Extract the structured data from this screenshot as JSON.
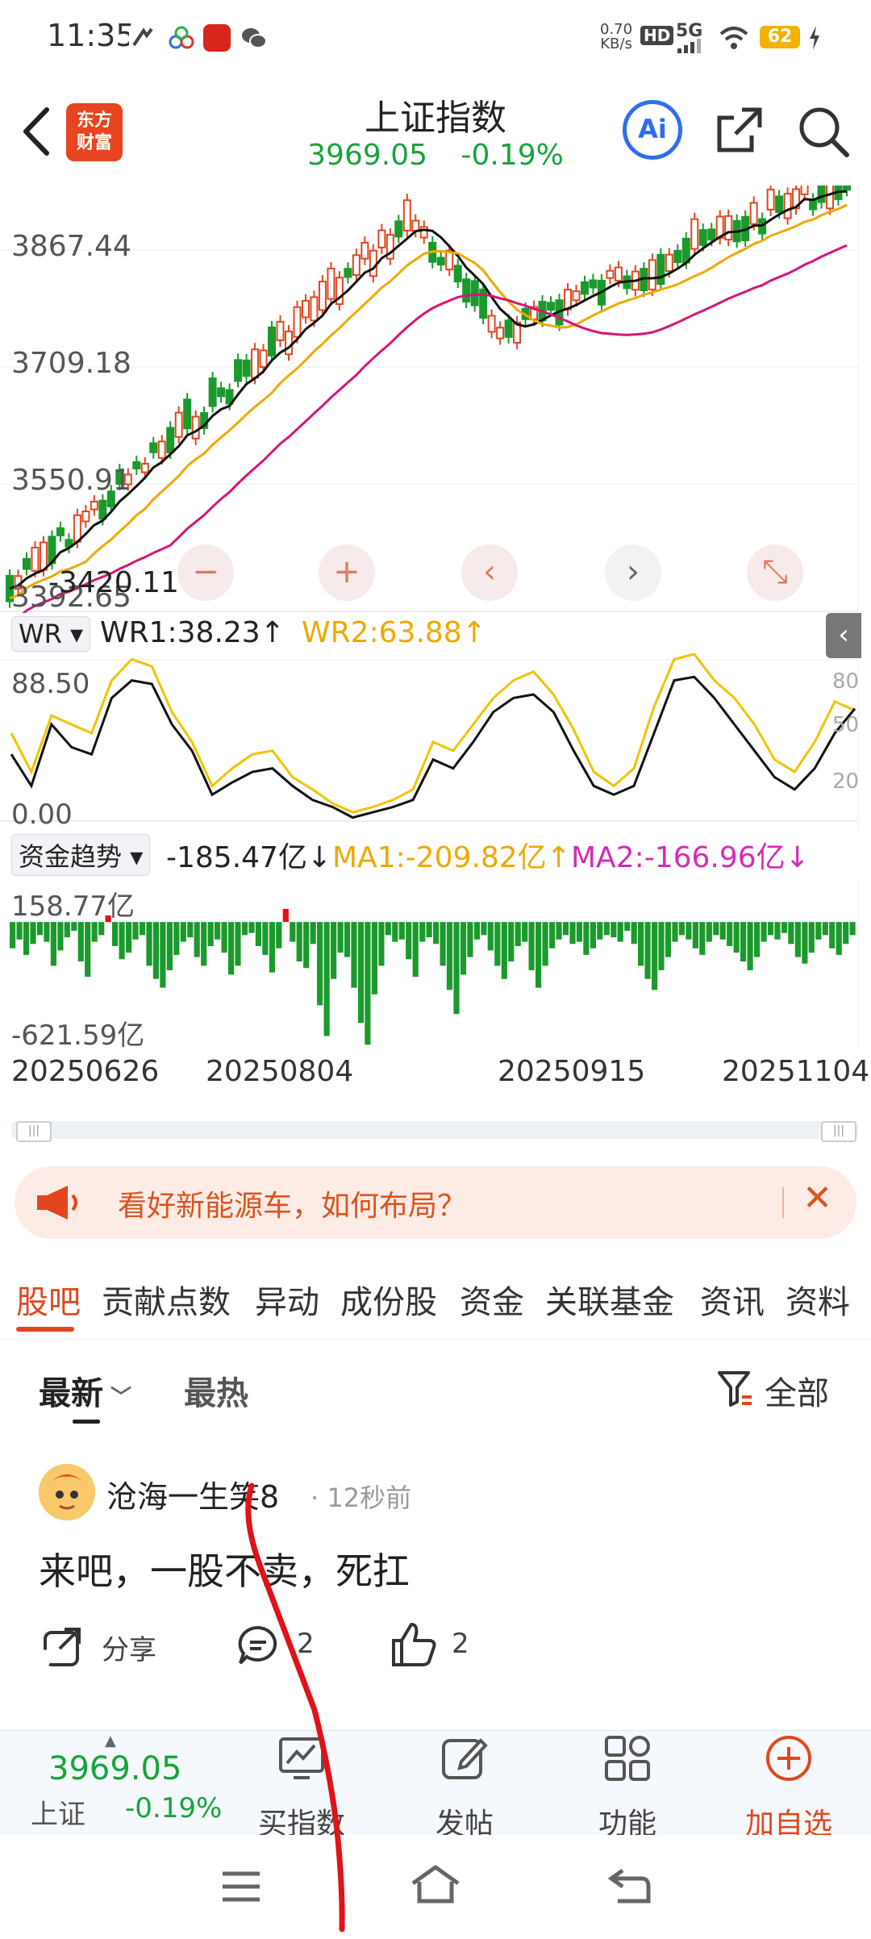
{
  "status_bar": {
    "time": "11:35",
    "net_speed_value": "0.70",
    "net_speed_unit": "KB/s",
    "hd_label": "HD",
    "network": "5G",
    "battery": "62"
  },
  "header": {
    "logo_text_line1": "东方",
    "logo_text_line2": "财富",
    "title": "上证指数",
    "price": "3969.05",
    "change": "-0.19%",
    "ai_label": "Ai"
  },
  "kline": {
    "y_labels": [
      "3867.44",
      "3709.18",
      "3550.91",
      "3392.65"
    ],
    "low_marker": "3420.11",
    "buttons": [
      "−",
      "+",
      "‹",
      "›",
      "⤡"
    ],
    "colors": {
      "up": "#e2461e",
      "down": "#1a9a2c",
      "ma5": "#111111",
      "ma10": "#f0a800",
      "ma20": "#d6157a",
      "seq": "#ff6a2b"
    }
  },
  "wr": {
    "selector": "WR",
    "wr1_label": "WR1:38.23↑",
    "wr2_label": "WR2:63.88↑",
    "y_top": "88.50",
    "y_bottom": "0.00",
    "right_labels": [
      "80",
      "50",
      "20"
    ],
    "wr1_values": [
      38,
      20,
      55,
      42,
      38,
      70,
      80,
      78,
      55,
      40,
      15,
      22,
      28,
      30,
      20,
      12,
      8,
      2,
      5,
      8,
      12,
      35,
      30,
      45,
      62,
      70,
      72,
      62,
      40,
      20,
      15,
      20,
      50,
      80,
      82,
      70,
      55,
      40,
      25,
      18,
      30,
      50,
      64
    ],
    "wr2_values": [
      50,
      28,
      60,
      55,
      50,
      80,
      92,
      88,
      62,
      45,
      20,
      30,
      38,
      40,
      25,
      18,
      10,
      5,
      8,
      12,
      18,
      45,
      40,
      55,
      70,
      80,
      85,
      72,
      52,
      28,
      20,
      30,
      65,
      92,
      95,
      80,
      70,
      55,
      35,
      28,
      45,
      68,
      63
    ]
  },
  "fund": {
    "selector": "资金趋势",
    "value_label": "-185.47亿↓",
    "ma1_label": "MA1:-209.82亿↑",
    "ma2_label": "MA2:-166.96亿↓",
    "y_top": "158.77亿",
    "y_bottom": "-621.59亿",
    "bars": [
      -120,
      -80,
      -150,
      -100,
      -60,
      -90,
      -200,
      -130,
      -70,
      -40,
      -180,
      -250,
      -90,
      -60,
      30,
      -110,
      -170,
      -140,
      -80,
      -60,
      -200,
      -260,
      -300,
      -220,
      -150,
      -90,
      -70,
      -160,
      -200,
      -110,
      -80,
      -140,
      -240,
      -200,
      -60,
      -50,
      -110,
      -150,
      -230,
      -120,
      60,
      -90,
      -180,
      -210,
      -100,
      -380,
      -520,
      -260,
      -140,
      -160,
      -300,
      -460,
      -560,
      -330,
      -200,
      -60,
      -90,
      -80,
      -170,
      -250,
      -90,
      -70,
      -100,
      -200,
      -310,
      -420,
      -240,
      -160,
      -80,
      -60,
      -130,
      -200,
      -260,
      -180,
      -110,
      -90,
      -220,
      -300,
      -200,
      -120,
      -80,
      -60,
      -100,
      -90,
      -150,
      -120,
      -80,
      -60,
      -70,
      -90,
      -40,
      -100,
      -200,
      -260,
      -310,
      -220,
      -160,
      -90,
      -60,
      -80,
      -120,
      -150,
      -90,
      -60,
      -80,
      -110,
      -140,
      -180,
      -220,
      -160,
      -90,
      -60,
      -80,
      -50,
      -100,
      -160,
      -190,
      -140,
      -80,
      -60,
      -120,
      -150,
      -100,
      -60
    ]
  },
  "x_dates": [
    "20250626",
    "20250804",
    "20250915",
    "20251104"
  ],
  "banner": {
    "text": "看好新能源车，如何布局？",
    "close": "✕"
  },
  "tabs": [
    "股吧",
    "贡献点数",
    "异动",
    "成份股",
    "资金",
    "关联基金",
    "资讯",
    "资料"
  ],
  "filter": {
    "latest": "最新",
    "hot": "最热",
    "all": "全部"
  },
  "post": {
    "username": "沧海一生笑8",
    "time": "12秒前",
    "body": "来吧，一股不卖，死扛",
    "share": "分享",
    "comments": "2",
    "likes": "2"
  },
  "bottom_bar": {
    "price": "3969.05",
    "name": "上证",
    "change": "-0.19%",
    "items": [
      "买指数",
      "发帖",
      "功能",
      "加自选"
    ]
  }
}
